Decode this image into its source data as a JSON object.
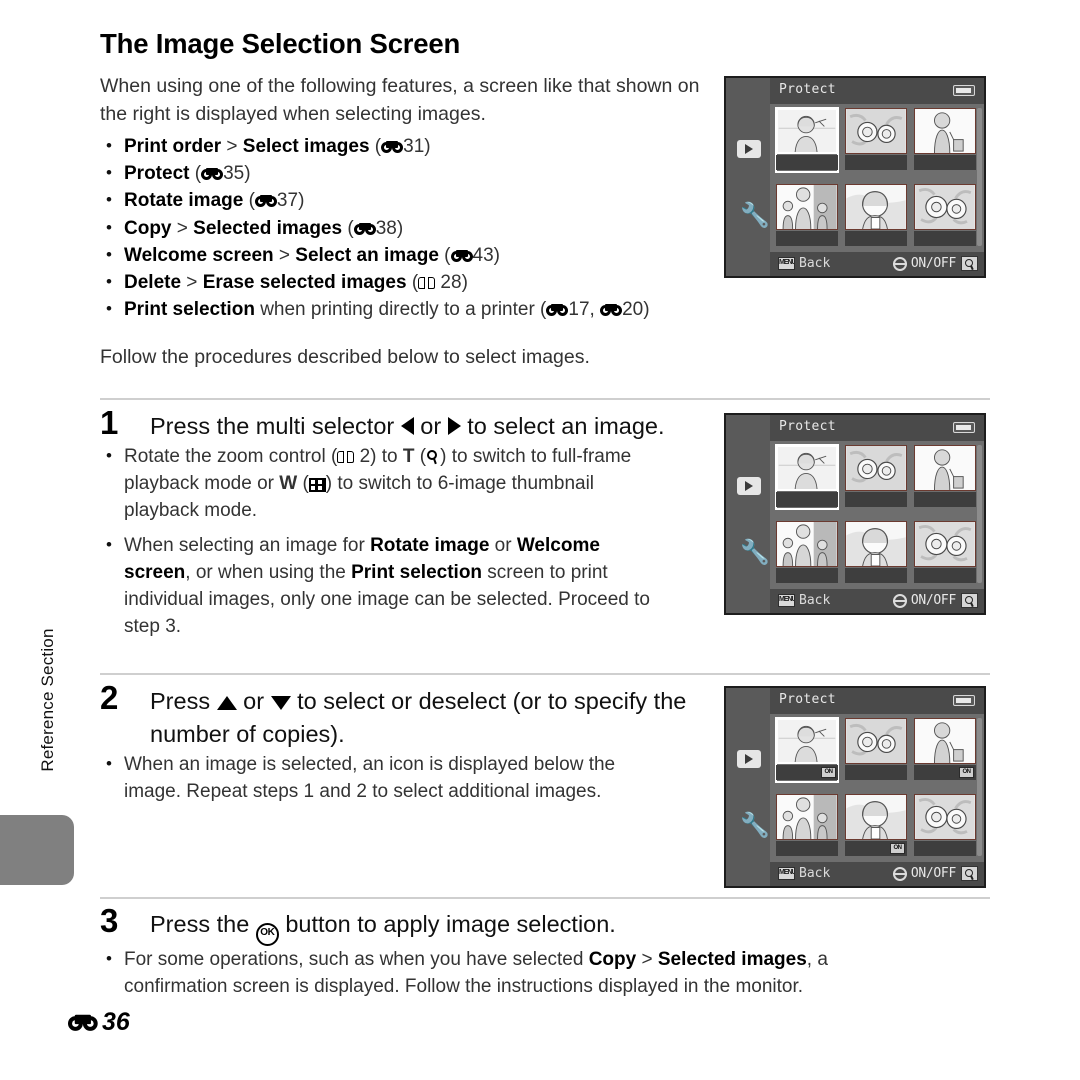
{
  "page": {
    "title": "The Image Selection Screen",
    "intro": "When using one of the following features, a screen like that shown on the right is displayed when selecting images.",
    "follow_line": "Follow the procedures described below to select images.",
    "footer_page": "36",
    "side_tab_label": "Reference Section"
  },
  "features": [
    {
      "bold1": "Print order",
      "sep": " > ",
      "bold2": "Select images",
      "ref_open": " (",
      "ref_icon": "reference-binocular-icon",
      "ref_num": "31",
      "ref_close": ")"
    },
    {
      "bold1": "Protect",
      "sep": "",
      "bold2": "",
      "ref_open": " (",
      "ref_icon": "reference-binocular-icon",
      "ref_num": "35",
      "ref_close": ")"
    },
    {
      "bold1": "Rotate image",
      "sep": "",
      "bold2": "",
      "ref_open": " (",
      "ref_icon": "reference-binocular-icon",
      "ref_num": "37",
      "ref_close": ")"
    },
    {
      "bold1": "Copy",
      "sep": " > ",
      "bold2": "Selected images",
      "ref_open": " (",
      "ref_icon": "reference-binocular-icon",
      "ref_num": "38",
      "ref_close": ")"
    },
    {
      "bold1": "Welcome screen",
      "sep": " > ",
      "bold2": "Select an image",
      "ref_open": " (",
      "ref_icon": "reference-binocular-icon",
      "ref_num": "43",
      "ref_close": ")"
    },
    {
      "bold1": "Delete",
      "sep": " > ",
      "bold2": "Erase selected images",
      "ref_open": " (",
      "ref_icon": "book-icon",
      "ref_num": " 28",
      "ref_close": ")"
    }
  ],
  "feature_last": {
    "bold1": "Print selection",
    "tail": " when printing directly to a printer (",
    "ref_num1": "17, ",
    "ref_num2": "20)"
  },
  "steps": [
    {
      "num": "1",
      "head_a": "Press the multi selector ",
      "head_b": " or ",
      "head_c": " to select an image.",
      "bullets": [
        {
          "a": "Rotate the zoom control (",
          "b": " 2) to ",
          "t_label": "T",
          "c": " (",
          "d": ") to switch to full-frame playback mode or ",
          "w_label": "W",
          "e": " (",
          "f": ") to switch to 6-image thumbnail playback mode."
        },
        {
          "a": "When selecting an image for ",
          "bold1": "Rotate image",
          "b": " or ",
          "bold2": "Welcome screen",
          "c": ", or when using the ",
          "bold3": "Print selection",
          "d": " screen to print individual images, only one image can be selected. Proceed to step 3."
        }
      ]
    },
    {
      "num": "2",
      "head_a": "Press ",
      "head_b": " or ",
      "head_c": " to select or deselect (or to specify the number of copies).",
      "bullets": [
        {
          "text": "When an image is selected, an icon is displayed below the image. Repeat steps 1 and 2 to select additional images."
        }
      ]
    },
    {
      "num": "3",
      "head_a": "Press the ",
      "head_ok": "OK",
      "head_c": " button to apply image selection.",
      "bullets": [
        {
          "a": "For some operations, such as when you have selected ",
          "bold1": "Copy",
          "b": " > ",
          "bold2": "Selected images",
          "c": ", a confirmation screen is displayed. Follow the instructions displayed in the monitor."
        }
      ]
    }
  ],
  "lcd": {
    "title": "Protect",
    "back_label": "Back",
    "menu_icon_label": "MENU",
    "onoff_label": "ON/OFF",
    "on_badge_label": "ON",
    "sidebar_icons": [
      "playback-icon",
      "setup-wrench-icon"
    ],
    "screens": [
      {
        "name": "screen-1-initial",
        "selected_index": 0,
        "on_badges": []
      },
      {
        "name": "screen-2-navigate",
        "selected_index": 0,
        "on_badges": []
      },
      {
        "name": "screen-3-marked",
        "selected_index": 0,
        "on_badges": [
          0,
          2,
          4
        ]
      }
    ],
    "thumbnails": [
      "portrait-woman",
      "flowers",
      "woman-with-bag",
      "family-group",
      "portrait-girl",
      "flowers-two"
    ]
  },
  "colors": {
    "lcd_body": "#6e6e6e",
    "lcd_sidebar": "#5a5a5a",
    "lcd_bar": "#4a4a4a",
    "tab_gray": "#808080",
    "rule": "#cfcfcf",
    "text": "#333333"
  }
}
